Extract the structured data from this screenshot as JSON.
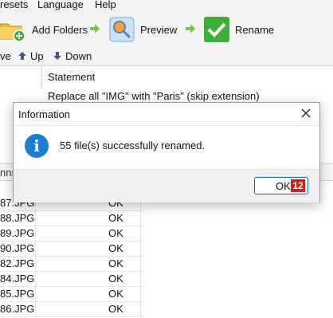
{
  "menu": {
    "items": [
      "resets",
      "Language",
      "Help"
    ]
  },
  "toolbar": {
    "add_folders": "Add Folders",
    "preview": "Preview",
    "rename": "Rename"
  },
  "subbar": {
    "remove": "ve",
    "up": "Up",
    "down": "Down"
  },
  "statements": {
    "header": "Statement",
    "row": "Replace all \"IMG\" with \"Paris\" (skip extension)"
  },
  "grid": {
    "header_fragment": "nns",
    "rows": [
      {
        "name": "87.JPG",
        "status": "OK"
      },
      {
        "name": "88.JPG",
        "status": "OK"
      },
      {
        "name": "89.JPG",
        "status": "OK"
      },
      {
        "name": "90.JPG",
        "status": "OK"
      },
      {
        "name": "82.JPG",
        "status": "OK"
      },
      {
        "name": "84.JPG",
        "status": "OK"
      },
      {
        "name": "85.JPG",
        "status": "OK"
      },
      {
        "name": "86.JPG",
        "status": "OK"
      }
    ]
  },
  "dialog": {
    "title": "Information",
    "message": "55 file(s) successfully renamed.",
    "ok_label": "OK",
    "badge": "12"
  },
  "colors": {
    "accent": "#0a64c8",
    "info": "#1a7fd4",
    "badge": "#d02020",
    "rename_green": "#3fae3a"
  }
}
